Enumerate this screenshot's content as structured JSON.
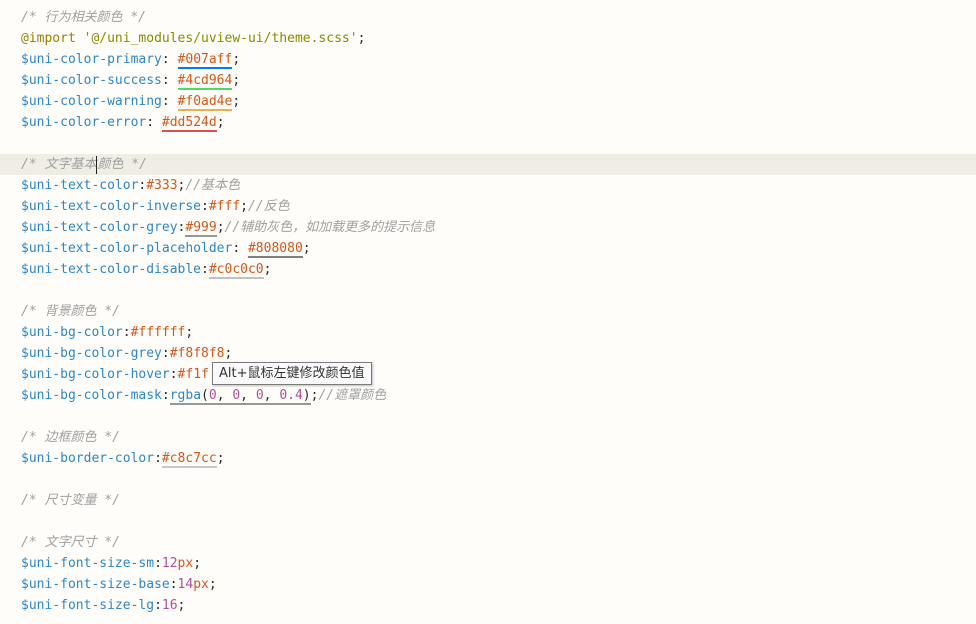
{
  "lines": {
    "l1": {
      "comment": "/* 行为相关颜色 */"
    },
    "l2": {
      "kw": "@import",
      "str": "'@/uni_modules/uview-ui/theme.scss'",
      "end": ";"
    },
    "l3": {
      "var": "$uni-color-primary",
      "sep": ": ",
      "val": "#007aff",
      "end": ";",
      "swatch": "#007aff"
    },
    "l4": {
      "var": "$uni-color-success",
      "sep": ": ",
      "val": "#4cd964",
      "end": ";",
      "swatch": "#4cd964"
    },
    "l5": {
      "var": "$uni-color-warning",
      "sep": ": ",
      "val": "#f0ad4e",
      "end": ";",
      "swatch": "#f0ad4e"
    },
    "l6": {
      "var": "$uni-color-error",
      "sep": ": ",
      "val": "#dd524d",
      "end": ";",
      "swatch": "#dd524d"
    },
    "l8": {
      "comment_a": "/* 文字基本",
      "comment_b": "颜色 */"
    },
    "l9": {
      "var": "$uni-text-color",
      "sep": ":",
      "val": "#333",
      "end": ";",
      "comment": "//基本色",
      "swatch": "#333333"
    },
    "l10": {
      "var": "$uni-text-color-inverse",
      "sep": ":",
      "val": "#fff",
      "end": ";",
      "comment": "//反色",
      "swatch": "#ffffff"
    },
    "l11": {
      "var": "$uni-text-color-grey",
      "sep": ":",
      "val": "#999",
      "end": ";",
      "comment": "//辅助灰色，如加载更多的提示信息",
      "swatch": "#999999"
    },
    "l12": {
      "var": "$uni-text-color-placeholder",
      "sep": ": ",
      "val": "#808080",
      "end": ";",
      "swatch": "#808080"
    },
    "l13": {
      "var": "$uni-text-color-disable",
      "sep": ":",
      "val": "#c0c0c0",
      "end": ";",
      "swatch": "#c0c0c0"
    },
    "l15": {
      "comment": "/* 背景颜色 */"
    },
    "l16": {
      "var": "$uni-bg-color",
      "sep": ":",
      "val": "#ffffff",
      "end": ";",
      "swatch": "#ffffff"
    },
    "l17": {
      "var": "$uni-bg-color-grey",
      "sep": ":",
      "val": "#f8f8f8",
      "end": ";",
      "swatch": "#f8f8f8"
    },
    "l18": {
      "var": "$uni-bg-color-hover",
      "sep": ":",
      "val": "#f1f",
      "end": ""
    },
    "l19": {
      "var": "$uni-bg-color-mask",
      "sep": ":",
      "fn": "rgba",
      "open": "(",
      "n1": "0",
      "c1": ", ",
      "n2": "0",
      "c2": ", ",
      "n3": "0",
      "c3": ", ",
      "n4": "0.4",
      "close": ")",
      "end": ";",
      "comment": "//遮罩颜色",
      "swatch": "rgba(0,0,0,0.4)"
    },
    "l21": {
      "comment": "/* 边框颜色 */"
    },
    "l22": {
      "var": "$uni-border-color",
      "sep": ":",
      "val": "#c8c7cc",
      "end": ";",
      "swatch": "#c8c7cc"
    },
    "l24": {
      "comment": "/* 尺寸变量 */"
    },
    "l26": {
      "comment": "/* 文字尺寸 */"
    },
    "l27": {
      "var": "$uni-font-size-sm",
      "sep": ":",
      "num": "12",
      "unit": "px",
      "end": ";"
    },
    "l28": {
      "var": "$uni-font-size-base",
      "sep": ":",
      "num": "14",
      "unit": "px",
      "end": ";"
    },
    "l29": {
      "var": "$uni-font-size-lg",
      "sep": ":",
      "num": "16",
      "end": ";"
    }
  },
  "tooltip": {
    "text": "Alt+鼠标左键修改颜色值"
  }
}
